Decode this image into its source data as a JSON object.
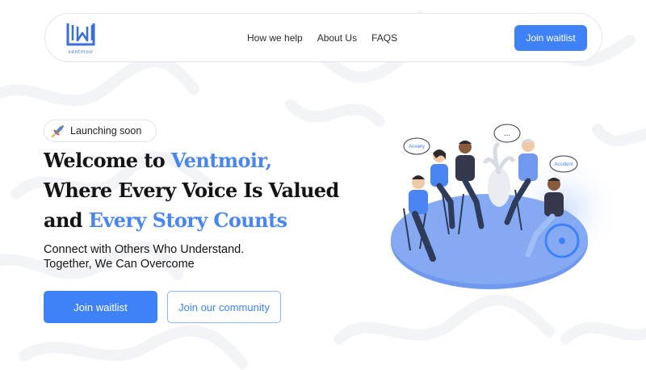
{
  "brand": {
    "name": "ventmoir",
    "accent_color": "#3f82f7"
  },
  "nav": {
    "links": [
      {
        "label": "How we help"
      },
      {
        "label": "About Us"
      },
      {
        "label": "FAQS"
      }
    ],
    "cta_label": "Join waitlist"
  },
  "hero": {
    "badge": {
      "icon": "rocket-icon",
      "label": "Launching soon"
    },
    "title": {
      "line1_plain": "Welcome to ",
      "line1_accent": "Ventmoir,",
      "line2": "Where Every Voice Is Valued",
      "line3_plain": "and ",
      "line3_accent": "Every Story Counts"
    },
    "subtitle": {
      "line1": "Connect with Others Who Understand.",
      "line2": "Together, We Can Overcome"
    },
    "primary_button": "Join waitlist",
    "secondary_button": "Join our community"
  },
  "illustration": {
    "bubbles": [
      "Anxiety",
      "Accident",
      "..."
    ]
  }
}
